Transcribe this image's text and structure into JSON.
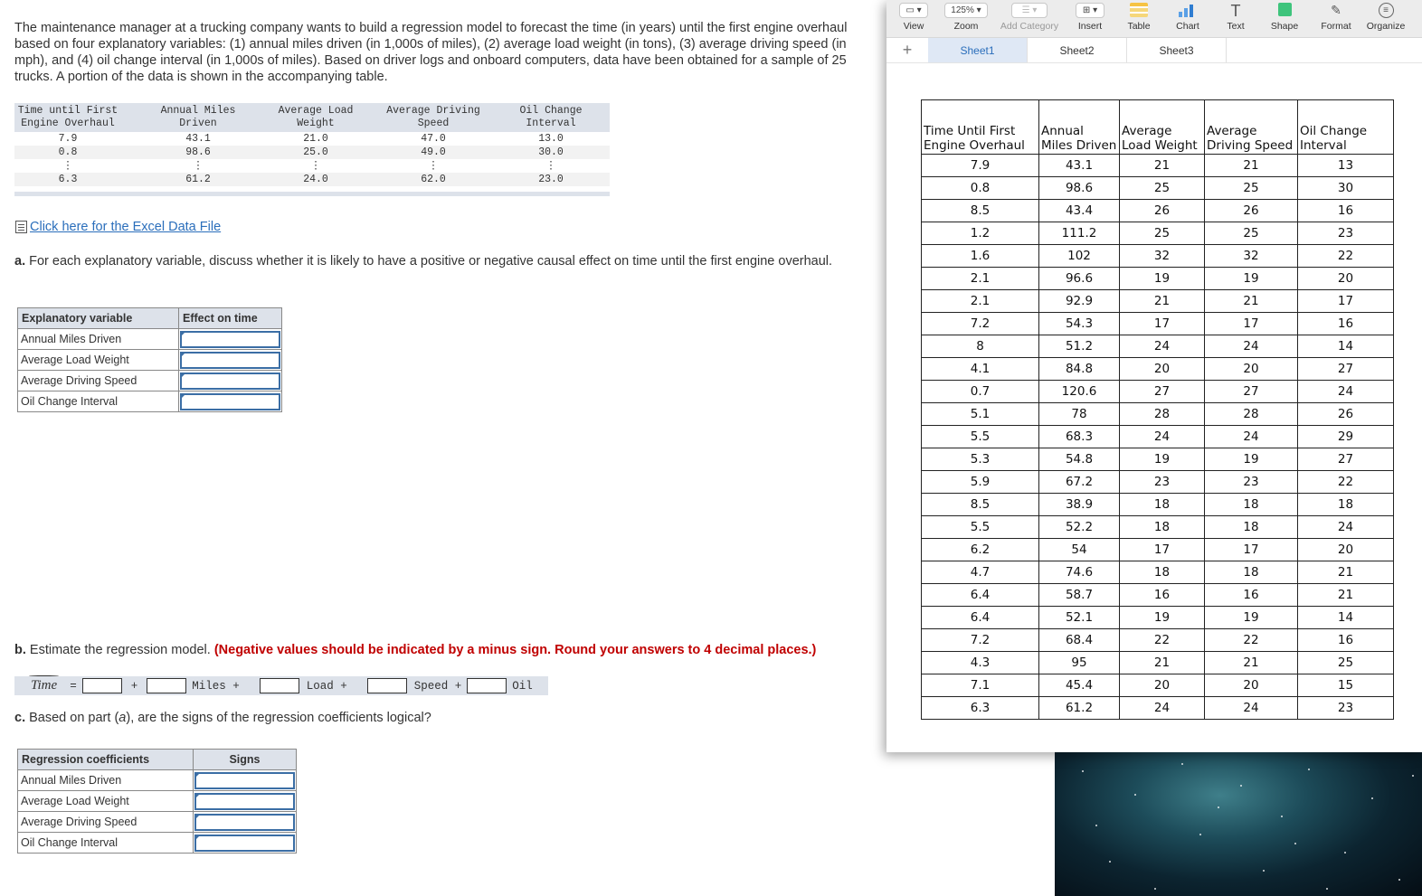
{
  "question": {
    "intro": "The maintenance manager at a trucking company wants to build a regression model to forecast the time (in years) until the first engine overhaul based on four explanatory variables: (1) annual miles driven (in 1,000s of miles), (2) average load weight (in tons), (3) average driving speed (in mph), and (4) oil change interval (in 1,000s of miles). Based on driver logs and onboard computers, data have been obtained for a sample of 25 trucks. A portion of the data is shown in the accompanying table.",
    "preview_table": {
      "headers": [
        [
          "Time until First",
          "Engine Overhaul"
        ],
        [
          "Annual Miles",
          "Driven"
        ],
        [
          "Average Load",
          "Weight"
        ],
        [
          "Average Driving",
          "Speed"
        ],
        [
          "Oil Change",
          "Interval"
        ]
      ],
      "rows": [
        [
          "7.9",
          "43.1",
          "21.0",
          "47.0",
          "13.0"
        ],
        [
          "0.8",
          "98.6",
          "25.0",
          "49.0",
          "30.0"
        ],
        [
          "⋮",
          "⋮",
          "⋮",
          "⋮",
          "⋮"
        ],
        [
          "6.3",
          "61.2",
          "24.0",
          "62.0",
          "23.0"
        ]
      ]
    },
    "excel_link": "Click here for the Excel Data File",
    "part_a": {
      "prefix": "a.",
      "text": "For each explanatory variable, discuss whether it is likely to have a positive or negative causal effect on time until the first engine overhaul.",
      "table": {
        "headers": [
          "Explanatory variable",
          "Effect on time"
        ],
        "rows": [
          "Annual Miles Driven",
          "Average Load Weight",
          "Average Driving Speed",
          "Oil Change Interval"
        ]
      }
    },
    "part_b": {
      "prefix": "b.",
      "text": "Estimate the regression model.",
      "instruction": "(Negative values should be indicated by a minus sign. Round your answers to 4 decimal places.)",
      "equation": {
        "lhs": "Time",
        "equals": "=",
        "terms": [
          "+",
          "Miles +",
          "Load +",
          "Speed +",
          "Oil"
        ]
      }
    },
    "part_c": {
      "prefix": "c.",
      "text_before": "Based on part (",
      "italic": "a",
      "text_after": "), are the signs of the regression coefficients logical?",
      "table": {
        "headers": [
          "Regression coefficients",
          "Signs"
        ],
        "rows": [
          "Annual Miles Driven",
          "Average Load Weight",
          "Average Driving Speed",
          "Oil Change Interval"
        ]
      }
    }
  },
  "numbers_app": {
    "toolbar": [
      {
        "label": "View",
        "icon": "sidebar-icon"
      },
      {
        "label": "Zoom",
        "value": "125%"
      },
      {
        "label": "Add Category",
        "icon": "list-icon",
        "disabled": true
      },
      {
        "label": "Insert",
        "icon": "insert-icon"
      },
      {
        "label": "Table",
        "icon": "table-icon"
      },
      {
        "label": "Chart",
        "icon": "chart-icon"
      },
      {
        "label": "Text",
        "icon": "text-icon"
      },
      {
        "label": "Shape",
        "icon": "shape-icon"
      },
      {
        "label": "Format",
        "icon": "format-brush-icon"
      },
      {
        "label": "Organize",
        "icon": "organize-icon"
      }
    ],
    "sheets": [
      "Sheet1",
      "Sheet2",
      "Sheet3"
    ],
    "active_sheet": "Sheet1",
    "table": {
      "headers": [
        [
          "Time Until First",
          "Engine Overhaul"
        ],
        [
          "Annual",
          "Miles Driven"
        ],
        [
          "Average",
          "Load Weight"
        ],
        [
          "Average",
          "Driving Speed"
        ],
        [
          "Oil Change",
          "Interval"
        ]
      ],
      "rows": [
        [
          "7.9",
          "43.1",
          "21",
          "21",
          "13"
        ],
        [
          "0.8",
          "98.6",
          "25",
          "25",
          "30"
        ],
        [
          "8.5",
          "43.4",
          "26",
          "26",
          "16"
        ],
        [
          "1.2",
          "111.2",
          "25",
          "25",
          "23"
        ],
        [
          "1.6",
          "102",
          "32",
          "32",
          "22"
        ],
        [
          "2.1",
          "96.6",
          "19",
          "19",
          "20"
        ],
        [
          "2.1",
          "92.9",
          "21",
          "21",
          "17"
        ],
        [
          "7.2",
          "54.3",
          "17",
          "17",
          "16"
        ],
        [
          "8",
          "51.2",
          "24",
          "24",
          "14"
        ],
        [
          "4.1",
          "84.8",
          "20",
          "20",
          "27"
        ],
        [
          "0.7",
          "120.6",
          "27",
          "27",
          "24"
        ],
        [
          "5.1",
          "78",
          "28",
          "28",
          "26"
        ],
        [
          "5.5",
          "68.3",
          "24",
          "24",
          "29"
        ],
        [
          "5.3",
          "54.8",
          "19",
          "19",
          "27"
        ],
        [
          "5.9",
          "67.2",
          "23",
          "23",
          "22"
        ],
        [
          "8.5",
          "38.9",
          "18",
          "18",
          "18"
        ],
        [
          "5.5",
          "52.2",
          "18",
          "18",
          "24"
        ],
        [
          "6.2",
          "54",
          "17",
          "17",
          "20"
        ],
        [
          "4.7",
          "74.6",
          "18",
          "18",
          "21"
        ],
        [
          "6.4",
          "58.7",
          "16",
          "16",
          "21"
        ],
        [
          "6.4",
          "52.1",
          "19",
          "19",
          "14"
        ],
        [
          "7.2",
          "68.4",
          "22",
          "22",
          "16"
        ],
        [
          "4.3",
          "95",
          "21",
          "21",
          "25"
        ],
        [
          "7.1",
          "45.4",
          "20",
          "20",
          "15"
        ],
        [
          "6.3",
          "61.2",
          "24",
          "24",
          "23"
        ]
      ]
    }
  },
  "colors": {
    "link": "#2a6ebb",
    "instruction_red": "#c00000",
    "table_header_bg": "#dde2ea",
    "input_border": "#3b6ea5",
    "active_tab_bg": "#dfe8f5"
  }
}
